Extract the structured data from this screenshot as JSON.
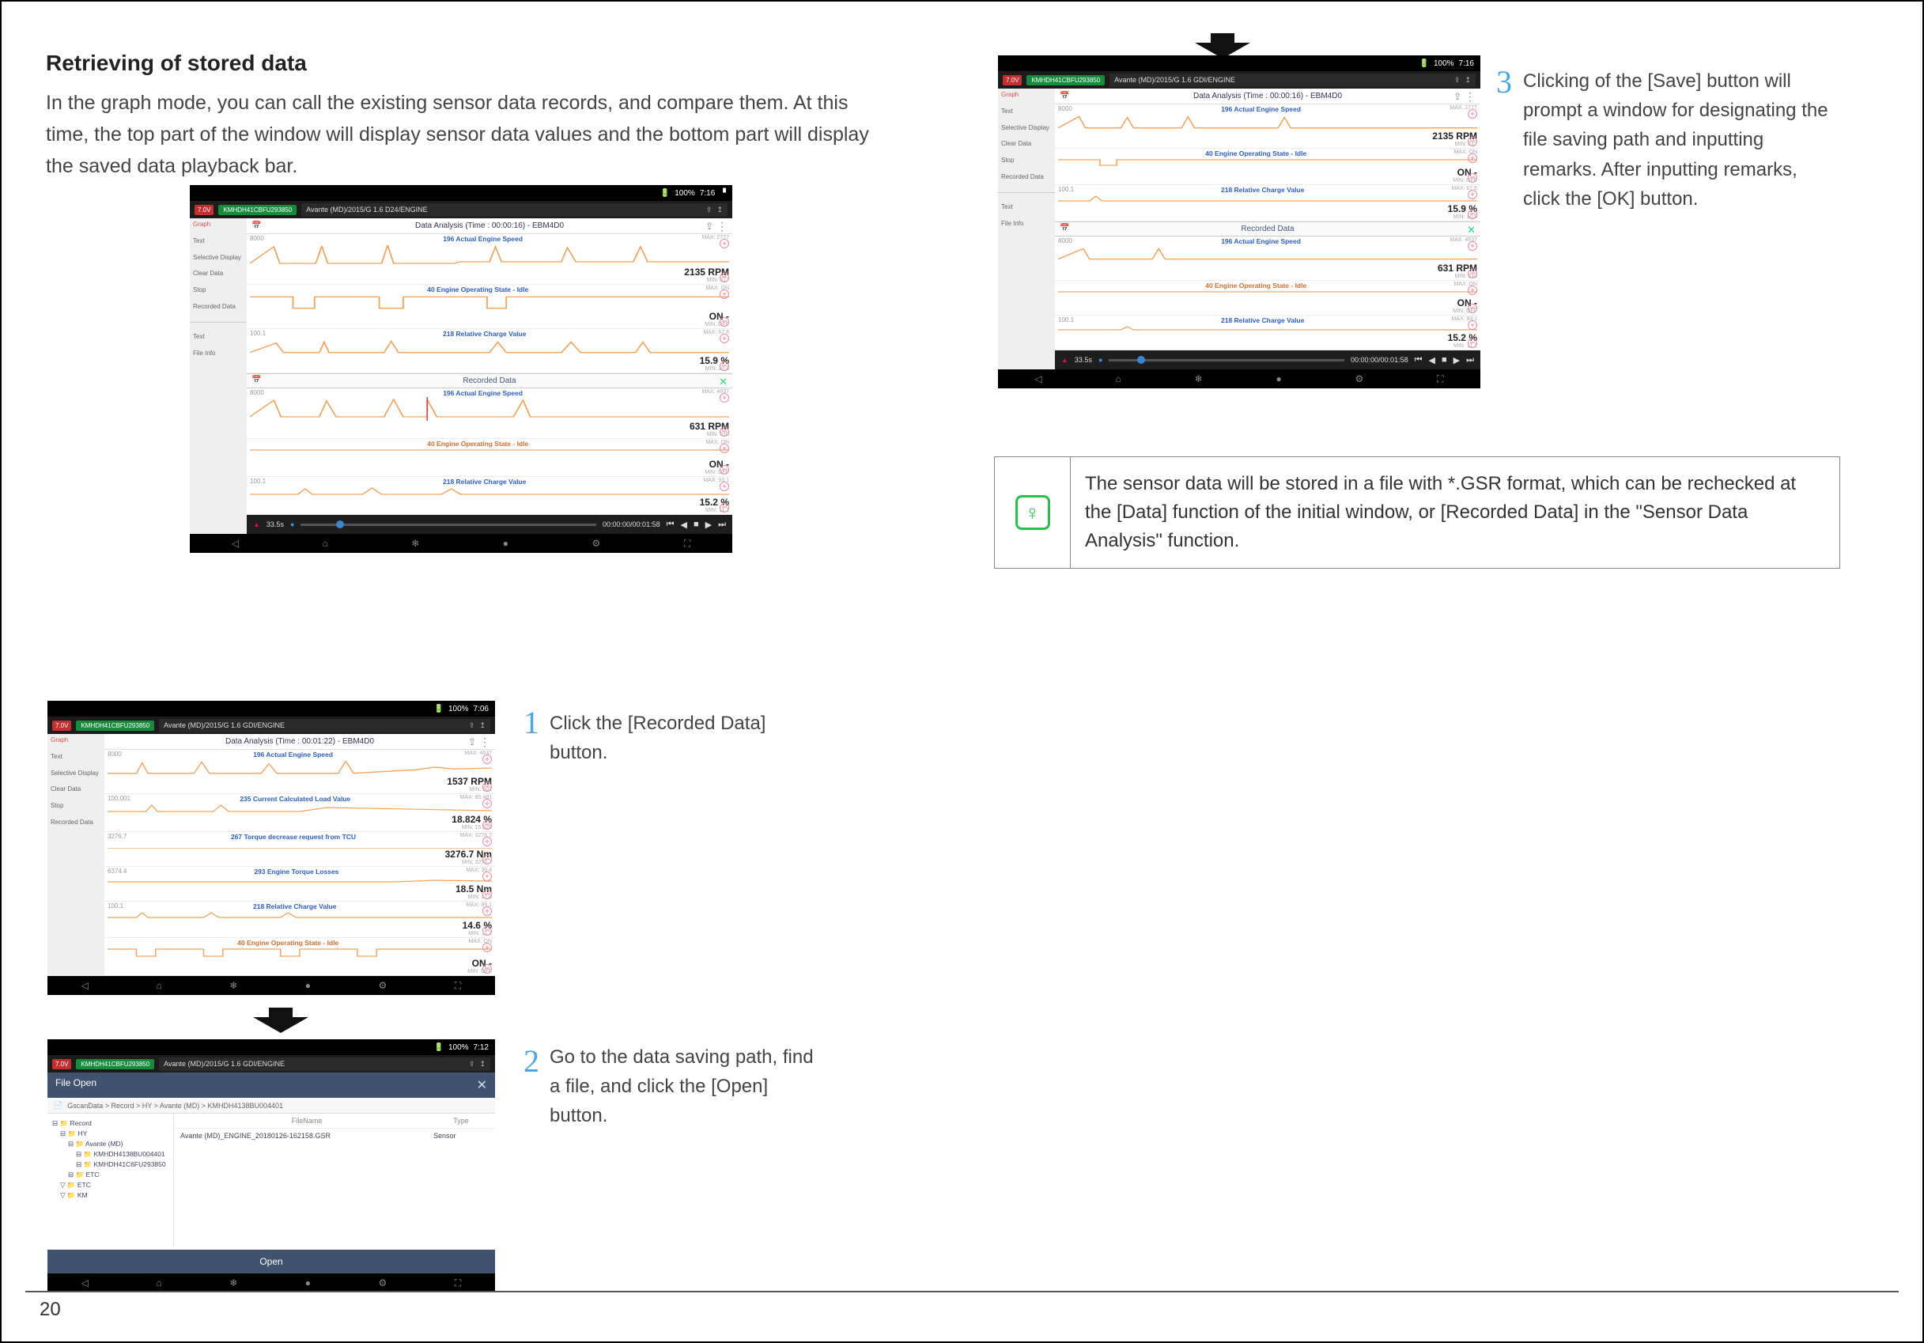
{
  "page_number": "20",
  "title": "Retrieving of stored data",
  "intro": "In the graph mode, you can call the existing sensor data records, and compare them. At this time, the top part of the window will display sensor data values and the bottom part will display the saved data playback bar.",
  "steps": {
    "1": "Click the [Recorded Data] button.",
    "2": "Go to the data saving path, find a file, and click the [Open] button.",
    "3": "Clicking of the [Save] button will prompt a window for designating the file saving path and inputting remarks. After inputting remarks, click the [OK] button."
  },
  "tip": "The sensor data will be stored in a file with *.GSR format, which can be rechecked at the [Data] function of the initial window, or [Recorded Data] in the \"Sensor Data Analysis\" function.",
  "status": {
    "batt": "100%",
    "time": "7:16",
    "time2": "7:06",
    "time3": "7:12"
  },
  "topbar": {
    "red_pill": "7.0V",
    "green_pill": "KMHDH41CBFU293850",
    "crumb_3": "Avante (MD)/2015/G 1.6 GDI/ENGINE",
    "crumb_1": "Avante (MD)/2015/G 1.6 D24/ENGINE"
  },
  "sidebar": {
    "graph": "Graph",
    "text": "Text",
    "selective": "Selective Display",
    "clear": "Clear Data",
    "stop": "Stop",
    "recorded": "Recorded Data",
    "fileinfo": "File Info"
  },
  "da_header": {
    "main": "Data Analysis (Time : 00:00:16) - EBM4D0",
    "step1": "Data Analysis (Time : 00:01:22) - EBM4D0"
  },
  "rec_header": "Recorded Data",
  "sensors_main": [
    {
      "y": "8000",
      "name": "196 Actual Engine Speed",
      "max": "MAX: 2777",
      "val": "2135 RPM",
      "min": "MIN: 617"
    },
    {
      "y": "",
      "name": "40 Engine Operating State - Idle",
      "max": "MAX: ON",
      "val": "ON -",
      "min": "MIN: OFF"
    },
    {
      "y": "100.1",
      "name": "218 Relative Charge Value",
      "max": "MAX: 67.6",
      "val": "15.9 %",
      "min": "MIN: 10.8"
    }
  ],
  "sensors_rec": [
    {
      "y": "8000",
      "name": "196 Actual Engine Speed",
      "max": "MAX: 4637",
      "val": "631 RPM",
      "min": "MIN: 610"
    },
    {
      "y": "",
      "name": "40 Engine Operating State - Idle",
      "max": "MAX: ON",
      "val": "ON -",
      "min": "MIN: OFF"
    },
    {
      "y": "100.1",
      "name": "218 Relative Charge Value",
      "max": "MAX: 93.1",
      "val": "15.2 %",
      "min": "MIN: 11.1"
    }
  ],
  "sensors_step1": [
    {
      "y": "8000",
      "name": "196 Actual Engine Speed",
      "max": "MAX: 4637",
      "val": "1537 RPM",
      "min": "MIN: 601"
    },
    {
      "y": "100.001",
      "name": "235 Current Calculated Load Value",
      "max": "MAX: 85.491",
      "val": "18.824 %",
      "min": "MIN: 15.529"
    },
    {
      "y": "3276.7",
      "name": "267 Torque decrease request from TCU",
      "max": "MAX: 3276.7",
      "val": "3276.7 Nm",
      "min": "MIN: 3276.7"
    },
    {
      "y": "6374.4",
      "name": "293 Engine Torque Losses",
      "max": "MAX: 30.4",
      "val": "18.5 Nm",
      "min": "MIN: 12.8"
    },
    {
      "y": "100.1",
      "name": "218 Relative Charge Value",
      "max": "MAX: 89.1",
      "val": "14.6 %",
      "min": "MIN: 11.1"
    },
    {
      "y": "",
      "name": "40 Engine Operating State - Idle",
      "max": "MAX: ON",
      "val": "ON -",
      "min": "MIN: OFF"
    }
  ],
  "play": {
    "pos": "33.5s",
    "total": "00:00:00/00:01:58"
  },
  "file_open": {
    "title": "File Open",
    "crumb": "GscanData > Record > HY > Avante (MD) > KMHDH4138BU004401",
    "tree": [
      "Record",
      "HY",
      "Avante (MD)",
      "KMHDH4138BU004401",
      "KMHDH41C6FU293850",
      "ETC",
      "ETC",
      "KM"
    ],
    "col_file": "FileName",
    "col_type": "Type",
    "file": "Avante (MD)_ENGINE_20180126-162158.GSR",
    "ftype": "Sensor",
    "open": "Open"
  }
}
